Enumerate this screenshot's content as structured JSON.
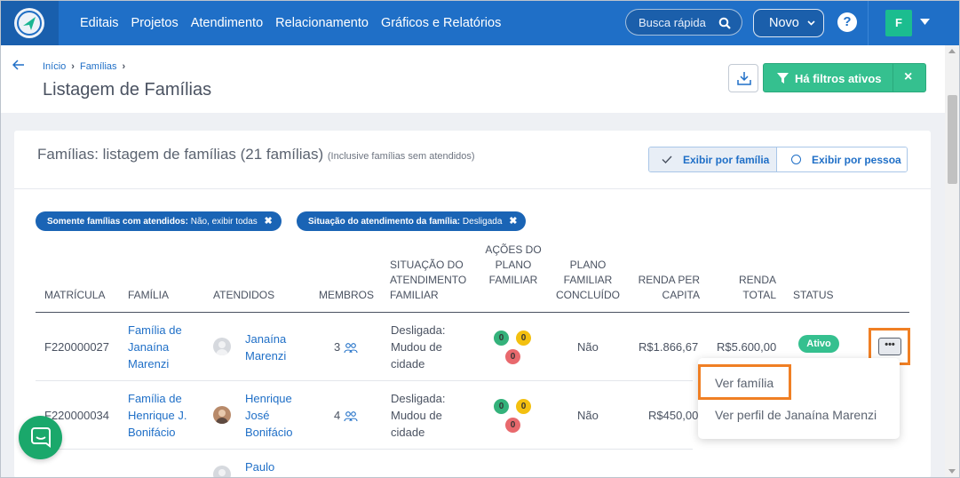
{
  "nav": {
    "items": [
      "Editais",
      "Projetos",
      "Atendimento",
      "Relacionamento",
      "Gráficos e Relatórios"
    ],
    "search_label": "Busca rápida",
    "new_label": "Novo",
    "help_label": "?",
    "user_initial": "F",
    "icons": [
      "logo-icon",
      "search-icon",
      "chevron-down-icon",
      "help-icon",
      "caret-down-icon"
    ]
  },
  "header": {
    "breadcrumb": [
      "Início",
      "Famílias"
    ],
    "title": "Listagem de Famílias",
    "filter_label": "Há filtros ativos",
    "filter_close": "×"
  },
  "card": {
    "title": "Famílias: listagem de famílias (21 famílias)",
    "subtitle": "(Inclusive famílias sem atendidos)",
    "view_family": "Exibir por família",
    "view_person": "Exibir por pessoa"
  },
  "chips": [
    {
      "key": "Somente famílias com atendidos:",
      "value": "Não, exibir todas"
    },
    {
      "key": "Situação do atendimento da família:",
      "value": "Desligada"
    }
  ],
  "columns": {
    "matricula": "Matrícula",
    "familia": "Família",
    "atendidos": "Atendidos",
    "membros": "Membros",
    "situacao": "Situação do atendimento familiar",
    "acoes": "Ações do plano familiar",
    "concluido": "Plano familiar concluído",
    "renda_capita": "Renda per capita",
    "renda_total": "Renda total",
    "status": "Status"
  },
  "rows": [
    {
      "matricula": "F220000027",
      "familia": "Família de Janaína Marenzi",
      "atendido": "Janaína Marenzi",
      "membros": "3",
      "situacao": "Desligada: Mudou de cidade",
      "acoes": [
        "0",
        "0",
        "0"
      ],
      "concluido": "Não",
      "renda_capita": "R$1.866,67",
      "renda_total": "R$5.600,00",
      "status": "Ativo"
    },
    {
      "matricula": "F220000034",
      "familia": "Família de Henrique J. Bonifácio",
      "atendido": "Henrique José Bonifácio",
      "membros": "4",
      "situacao": "Desligada: Mudou de cidade",
      "acoes": [
        "0",
        "0",
        "0"
      ],
      "concluido": "Não",
      "renda_capita": "R$450,00",
      "renda_total": "",
      "status": ""
    },
    {
      "matricula": "",
      "familia": "",
      "atendido": "Paulo",
      "membros": "",
      "situacao": "",
      "acoes": [],
      "concluido": "",
      "renda_capita": "",
      "renda_total": "",
      "status": ""
    }
  ],
  "row_menu": {
    "more_label": "•••",
    "items": [
      "Ver família",
      "Ver perfil de Janaína Marenzi"
    ]
  },
  "colors": {
    "nav_blue": "#1f6fc7",
    "green": "#35c08f",
    "highlight": "#f07f24",
    "chip_blue": "#1a64b5"
  }
}
